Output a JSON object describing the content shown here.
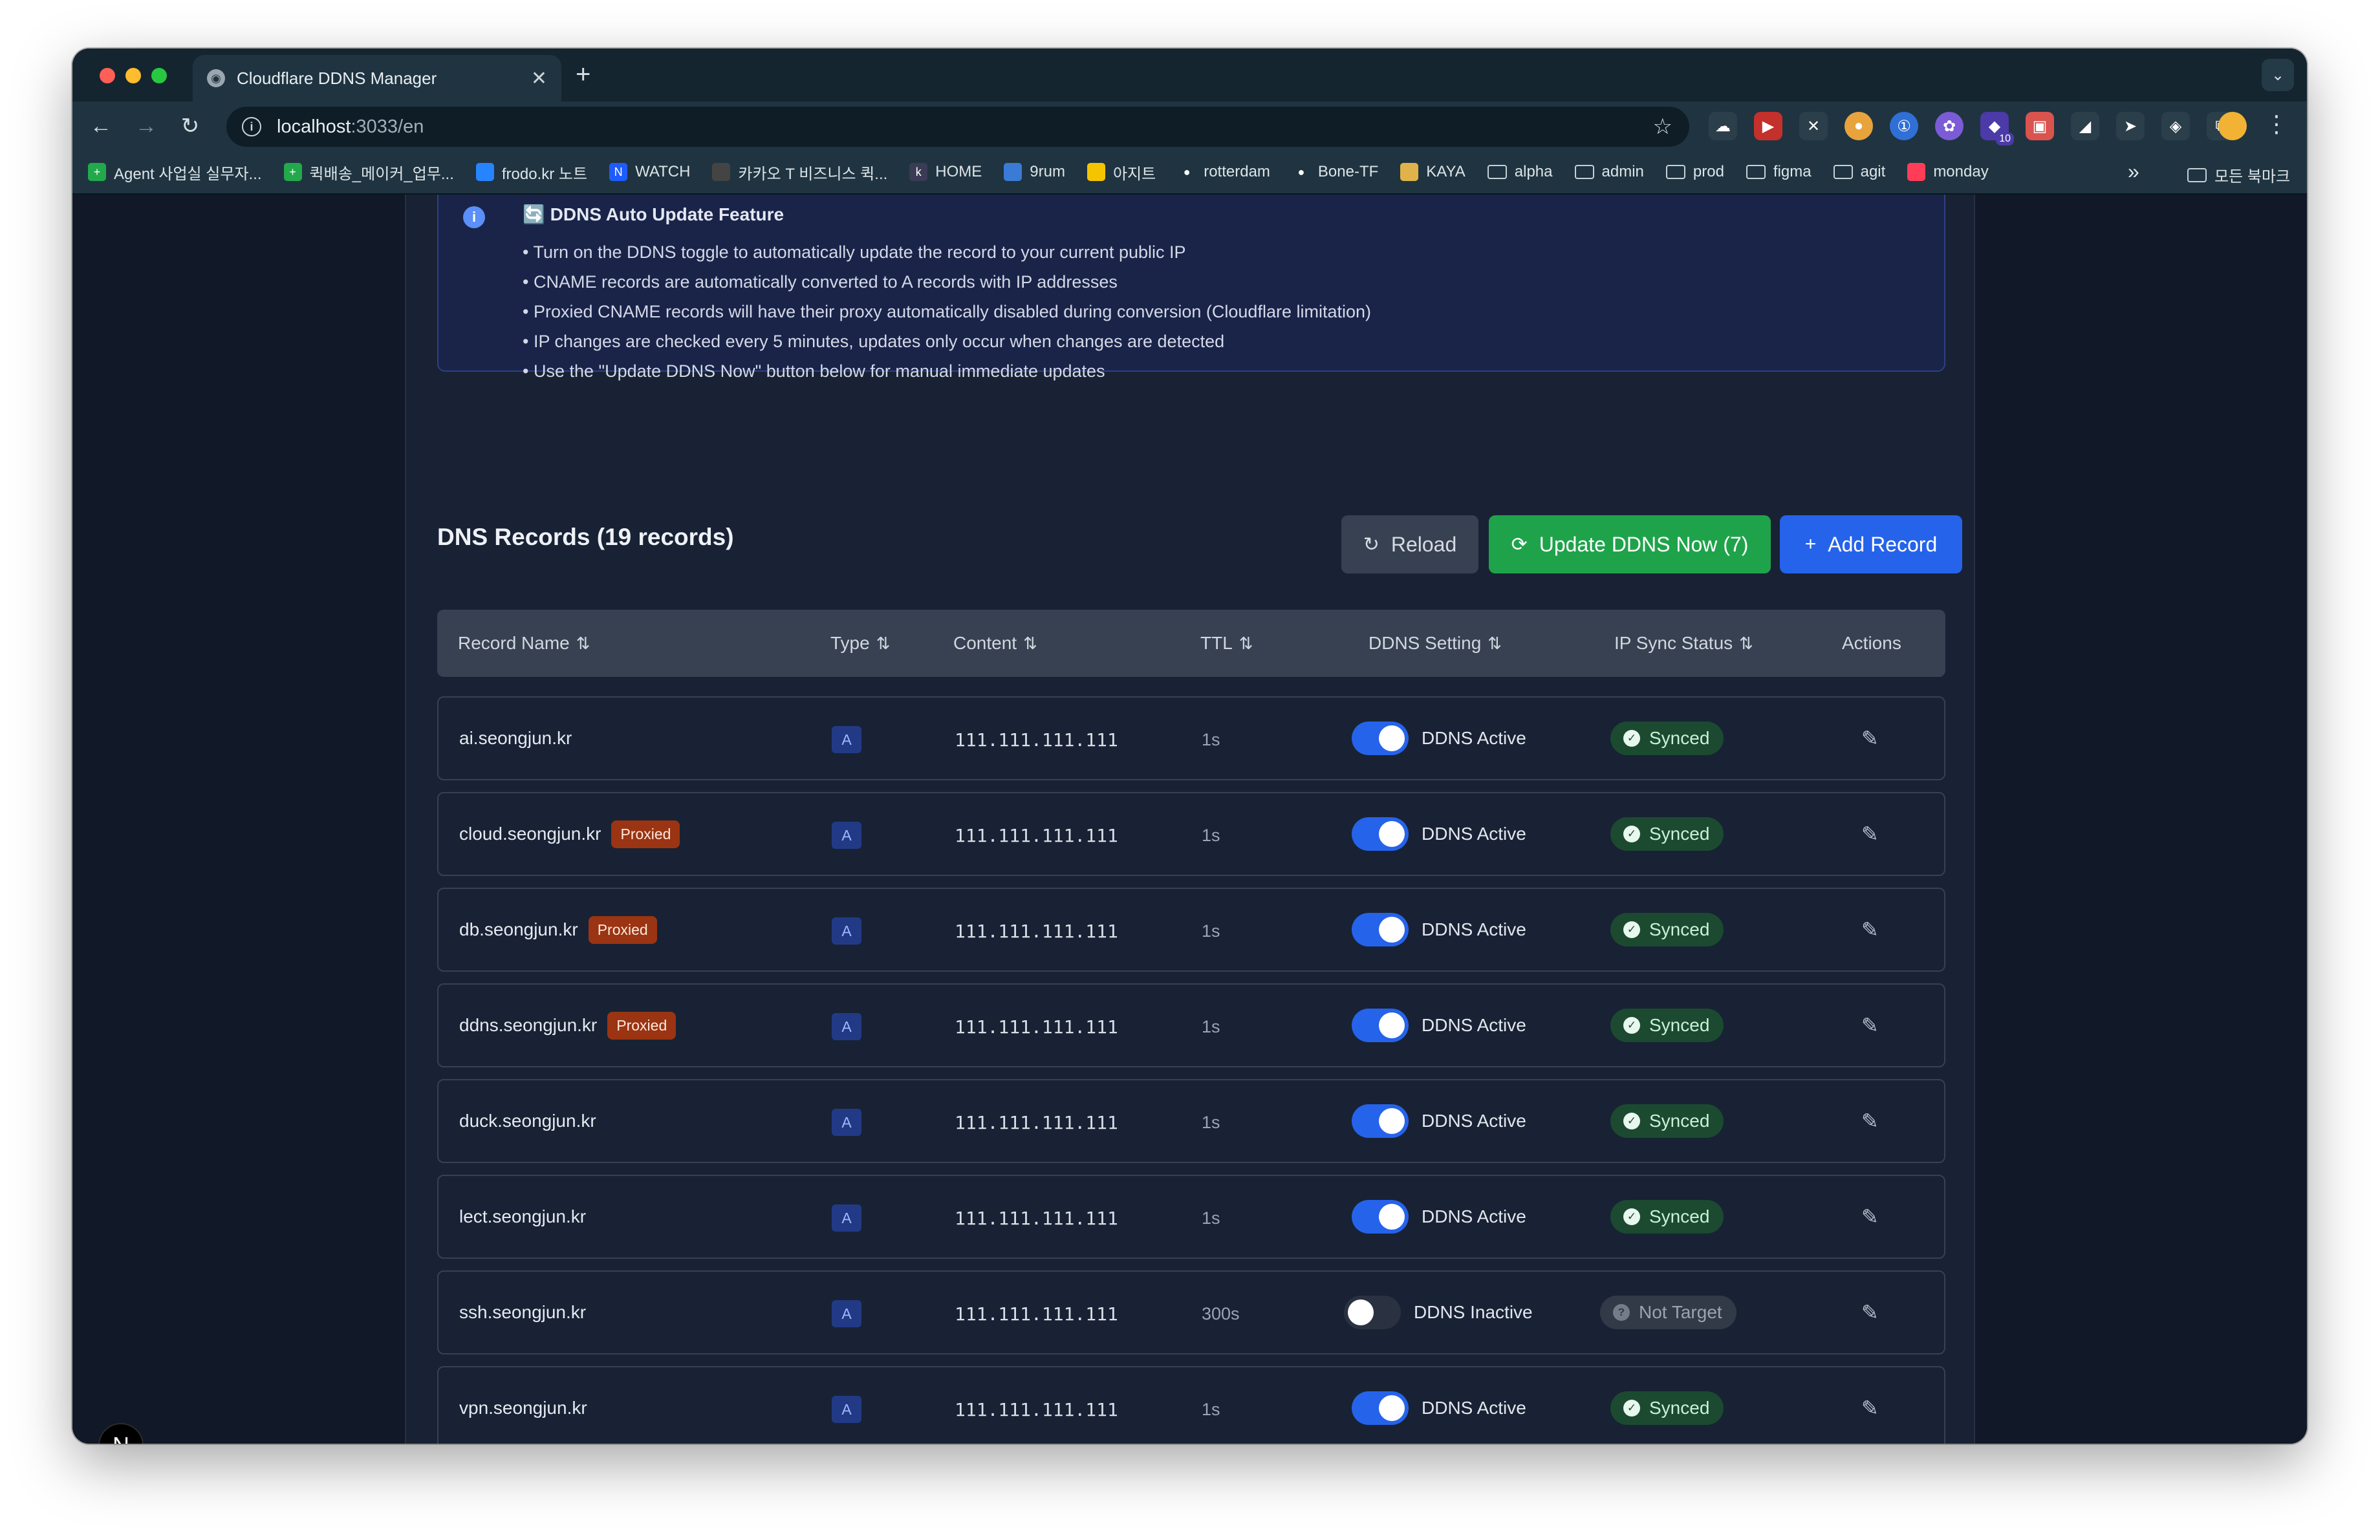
{
  "browser": {
    "tab_title": "Cloudflare DDNS Manager",
    "tab_close": "✕",
    "new_tab": "+",
    "url_host": "localhost",
    "url_rest": ":3033/en",
    "extension_badge": "10",
    "bookmarks": [
      {
        "label": "Agent 사업실 실무자...",
        "icon": "green-plus-icon",
        "color": "#22a94b"
      },
      {
        "label": "퀵배송_메이커_업무...",
        "icon": "green-plus-icon",
        "color": "#22a94b"
      },
      {
        "label": "frodo.kr 노트",
        "icon": "confluence-icon",
        "color": "#2684ff"
      },
      {
        "label": "WATCH",
        "icon": "notion-n-icon",
        "color": "#1f5cff"
      },
      {
        "label": "카카오 T 비즈니스 퀵...",
        "icon": "notion-icon",
        "color": "#444444"
      },
      {
        "label": "HOME",
        "icon": "k-icon",
        "color": "#3b3b55"
      },
      {
        "label": "9rum",
        "icon": "cloud-icon",
        "color": "#3a7bd5"
      },
      {
        "label": "아지트",
        "icon": "agit-icon",
        "color": "#f5c400"
      },
      {
        "label": "rotterdam",
        "icon": "github-icon",
        "color": "#ffffff"
      },
      {
        "label": "Bone-TF",
        "icon": "github-icon",
        "color": "#ffffff"
      },
      {
        "label": "KAYA",
        "icon": "kaya-icon",
        "color": "#e0b34a"
      },
      {
        "label": "alpha",
        "icon": "folder-icon"
      },
      {
        "label": "admin",
        "icon": "folder-icon"
      },
      {
        "label": "prod",
        "icon": "folder-icon"
      },
      {
        "label": "figma",
        "icon": "folder-icon"
      },
      {
        "label": "agit",
        "icon": "folder-icon"
      },
      {
        "label": "monday",
        "icon": "monday-icon",
        "color": "#ff3d57"
      }
    ],
    "bookmarks_more": "»",
    "all_bookmarks": "모든 북마크"
  },
  "info": {
    "title": "DDNS Auto Update Feature",
    "bullets": [
      "• Turn on the DDNS toggle to automatically update the record to your current public IP",
      "• CNAME records are automatically converted to A records with IP addresses",
      "• Proxied CNAME records will have their proxy automatically disabled during conversion (Cloudflare limitation)",
      "• IP changes are checked every 5 minutes, updates only occur when changes are detected",
      "• Use the \"Update DDNS Now\" button below for manual immediate updates"
    ]
  },
  "records_section": {
    "title": "DNS Records (19 records)",
    "reload_label": "Reload",
    "update_label": "Update DDNS Now (7)",
    "add_label": "Add Record"
  },
  "table": {
    "headers": {
      "name": "Record Name",
      "type": "Type",
      "content": "Content",
      "ttl": "TTL",
      "ddns": "DDNS Setting",
      "status": "IP Sync Status",
      "actions": "Actions"
    },
    "sort_glyph": "⇅",
    "rows": [
      {
        "name": "ai.seongjun.kr",
        "proxied": "",
        "type": "A",
        "content": "111.111.111.111",
        "ttl": "1s",
        "ddns_on": true,
        "ddns_label": "DDNS Active",
        "status": "Synced"
      },
      {
        "name": "cloud.seongjun.kr",
        "proxied": "Proxied",
        "type": "A",
        "content": "111.111.111.111",
        "ttl": "1s",
        "ddns_on": true,
        "ddns_label": "DDNS Active",
        "status": "Synced"
      },
      {
        "name": "db.seongjun.kr",
        "proxied": "Proxied",
        "type": "A",
        "content": "111.111.111.111",
        "ttl": "1s",
        "ddns_on": true,
        "ddns_label": "DDNS Active",
        "status": "Synced"
      },
      {
        "name": "ddns.seongjun.kr",
        "proxied": "Proxied",
        "type": "A",
        "content": "111.111.111.111",
        "ttl": "1s",
        "ddns_on": true,
        "ddns_label": "DDNS Active",
        "status": "Synced"
      },
      {
        "name": "duck.seongjun.kr",
        "proxied": "",
        "type": "A",
        "content": "111.111.111.111",
        "ttl": "1s",
        "ddns_on": true,
        "ddns_label": "DDNS Active",
        "status": "Synced"
      },
      {
        "name": "lect.seongjun.kr",
        "proxied": "",
        "type": "A",
        "content": "111.111.111.111",
        "ttl": "1s",
        "ddns_on": true,
        "ddns_label": "DDNS Active",
        "status": "Synced"
      },
      {
        "name": "ssh.seongjun.kr",
        "proxied": "",
        "type": "A",
        "content": "111.111.111.111",
        "ttl": "300s",
        "ddns_on": false,
        "ddns_label": "DDNS Inactive",
        "status": "Not Target"
      },
      {
        "name": "vpn.seongjun.kr",
        "proxied": "",
        "type": "A",
        "content": "111.111.111.111",
        "ttl": "1s",
        "ddns_on": true,
        "ddns_label": "DDNS Active",
        "status": "Synced"
      }
    ]
  },
  "next_badge": "N"
}
